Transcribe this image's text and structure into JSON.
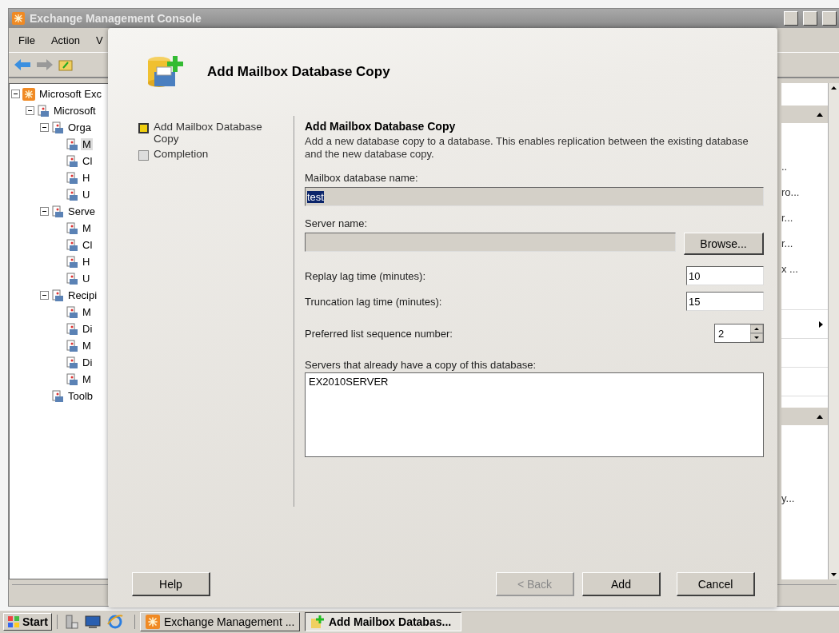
{
  "window": {
    "title": "Exchange Management Console"
  },
  "menu": [
    "File",
    "Action",
    "V"
  ],
  "tree": [
    {
      "label": "Microsoft Exc",
      "expanded": true,
      "children": [
        {
          "label": "Microsoft",
          "expanded": true,
          "children": [
            {
              "label": "Orga",
              "expanded": true,
              "children": [
                {
                  "label": "M",
                  "selected": true
                },
                {
                  "label": "Cl",
                  "selected": false
                },
                {
                  "label": "H",
                  "selected": false
                },
                {
                  "label": "U",
                  "selected": false
                }
              ]
            },
            {
              "label": "Serve",
              "expanded": true,
              "children": [
                {
                  "label": "M",
                  "selected": false
                },
                {
                  "label": "Cl",
                  "selected": false
                },
                {
                  "label": "H",
                  "selected": false
                },
                {
                  "label": "U",
                  "selected": false
                }
              ]
            },
            {
              "label": "Recipi",
              "expanded": true,
              "children": [
                {
                  "label": "M",
                  "selected": false
                },
                {
                  "label": "Di",
                  "selected": false
                },
                {
                  "label": "M",
                  "selected": false
                },
                {
                  "label": "Di",
                  "selected": false
                },
                {
                  "label": "M",
                  "selected": false
                }
              ]
            },
            {
              "label": "Toolb"
            }
          ]
        }
      ]
    }
  ],
  "action_pane": {
    "items": [
      "..",
      "ro...",
      "r...",
      "r...",
      "x ..."
    ],
    "lower_items": [
      "y..."
    ]
  },
  "dialog": {
    "title": "Add Mailbox Database Copy",
    "steps": [
      {
        "label": "Add Mailbox Database Copy",
        "selected": true
      },
      {
        "label": "Completion",
        "selected": false
      }
    ],
    "heading": "Add Mailbox Database Copy",
    "description": "Add a new database copy to a database. This enables replication between the existing database and the new database copy.",
    "fields": [
      {
        "kind": "readonly",
        "label": "Mailbox database name:",
        "value": "test"
      },
      {
        "kind": "browse",
        "label": "Server name:",
        "button": "Browse..."
      },
      {
        "kind": "number",
        "label": "Replay lag time (minutes):",
        "value": "10"
      },
      {
        "kind": "number",
        "label": "Truncation lag time (minutes):",
        "value": "15"
      },
      {
        "kind": "spin",
        "label": "Preferred list sequence number:",
        "value": "2"
      },
      {
        "kind": "list",
        "label": "Servers that already have a copy of this database:",
        "items": [
          "EX2010SERVER"
        ]
      }
    ],
    "buttons": [
      {
        "label": "Help",
        "disabled": false
      },
      {
        "label": "< Back",
        "disabled": true
      },
      {
        "label": "Add",
        "disabled": false
      },
      {
        "label": "Cancel",
        "disabled": false
      }
    ]
  },
  "taskbar": {
    "start": "Start",
    "tasks": [
      {
        "label": "Exchange Management ...",
        "selected": false
      },
      {
        "label": "Add Mailbox Databas...",
        "selected": true
      }
    ]
  }
}
